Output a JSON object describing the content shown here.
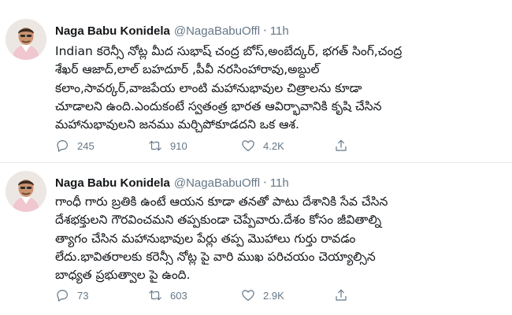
{
  "tweets": [
    {
      "author_name": "Naga Babu Konidela",
      "handle": "@NagaBabuOffl",
      "separator": "·",
      "time": "11h",
      "lines": [
        "Indian కరెన్సీ నోట్ల మీద సుభాష్ చంద్ర బోస్,అంబేద్కర్, భగత్ సింగ్,చంద్ర",
        "శేఖర్ ఆజాద్,లాల్ బహదూర్ ,పీవీ నరసింహారావు,అబ్దుల్",
        "కలాం,సావర్కర్,వాజపేయ లాంటి మహానుభావుల చిత్రాలను కూడా",
        "చూడాలని ఉంది.ఎందుకంటే స్వతంత్ర భారత ఆవిర్భావానికి కృషి చేసిన",
        "మహానుభావులని జనము మర్చిపోకూడదని ఒక ఆశ."
      ],
      "replies": "245",
      "retweets": "910",
      "likes": "4.2K"
    },
    {
      "author_name": "Naga Babu Konidela",
      "handle": "@NagaBabuOffl",
      "separator": "·",
      "time": "11h",
      "lines": [
        "గాంధీ గారు బ్రతికి ఉంటే ఆయన కూడా తనతో పాటు దేశానికి సేవ చేసిన",
        "దేశభక్తులని గౌరవించమని తప్పకుండా చెప్పేవారు.దేశం కోసం జీవితాల్ని",
        "త్యాగం చేసిన మహానుభావుల పేర్లు తప్ప మొహాలు గుర్తు రావడం",
        "లేదు.భావితరాలకు కరెన్సీ నోట్ల పై వారి ముఖ పరిచయం చెయ్యాల్సిన",
        "బాధ్యత ప్రభుత్వాల పై ఉంది."
      ],
      "replies": "73",
      "retweets": "603",
      "likes": "2.9K"
    }
  ],
  "icons": [
    "reply-icon",
    "retweet-icon",
    "like-icon",
    "share-icon"
  ]
}
